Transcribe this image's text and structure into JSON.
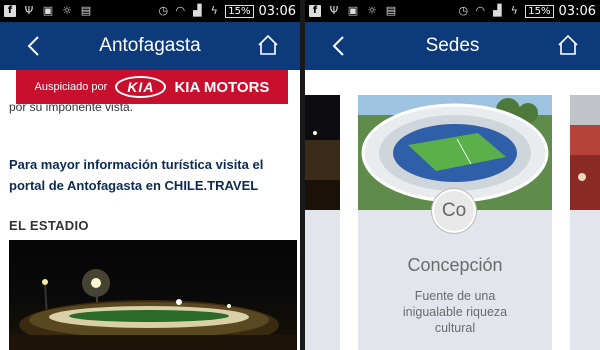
{
  "status": {
    "time": "03:06",
    "battery": "15%"
  },
  "left": {
    "title": "Antofagasta",
    "ad": {
      "sponsor": "Auspiciado por",
      "kia": "KIA",
      "brand": "KIA MOTORS"
    },
    "cut_text": "por su imponente vista.",
    "info": "Para mayor información turística visita el portal de Antofagasta en CHILE.TRAVEL",
    "section": "EL ESTADIO"
  },
  "right": {
    "title": "Sedes",
    "card": {
      "badge": "Co",
      "city": "Concepción",
      "description": "Fuente de una inigualable riqueza cultural"
    }
  },
  "colors": {
    "appbar": "#0d3a7a",
    "ad": "#c8102e",
    "card": "#e2e6ec"
  }
}
